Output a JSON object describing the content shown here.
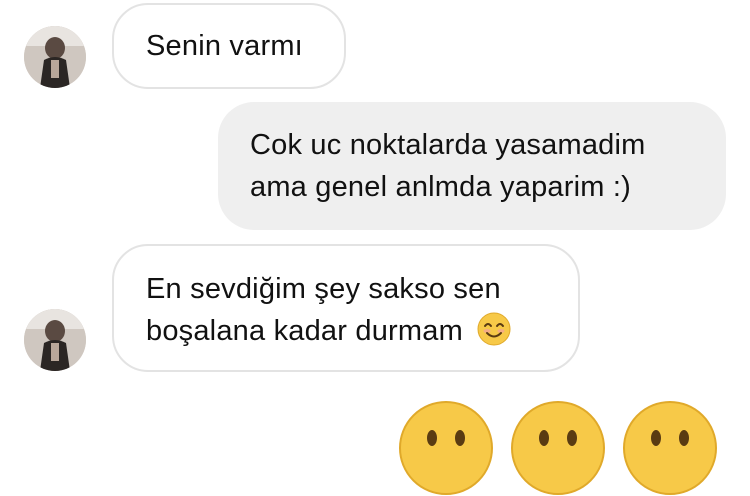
{
  "messages": [
    {
      "sender": "them",
      "text": "Senin varmı"
    },
    {
      "sender": "me",
      "lines": [
        "Cok uc noktalarda yasamadim",
        "ama genel anlmda yaparim :)"
      ]
    },
    {
      "sender": "them",
      "lines": [
        "En sevdiğim şey sakso sen",
        "boşalana kadar durmam"
      ],
      "trailing_emoji": "smiling-face-emoji"
    }
  ],
  "reaction_emojis": [
    "grinning-face-emoji",
    "grinning-face-emoji",
    "grinning-face-emoji"
  ],
  "colors": {
    "incoming_bubble": "#ffffff",
    "incoming_border": "#e3e3e3",
    "outgoing_bubble": "#efefef",
    "text": "#111111",
    "emoji_face": "#f7c948"
  }
}
